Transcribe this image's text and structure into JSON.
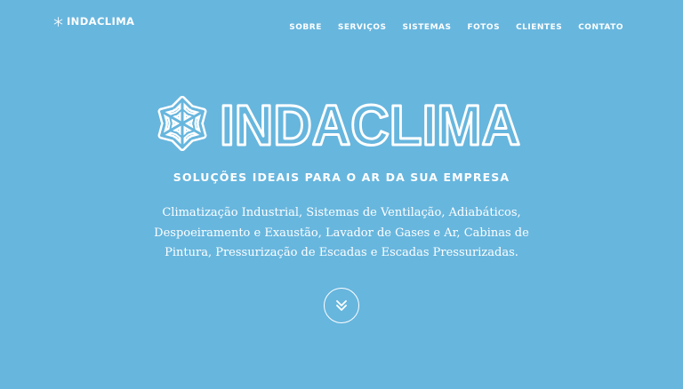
{
  "brand": {
    "name": "INDACLIMA",
    "logo_icon": "snowflake-icon"
  },
  "nav": {
    "items": [
      {
        "label": "SOBRE"
      },
      {
        "label": "SERVIÇOS"
      },
      {
        "label": "SISTEMAS"
      },
      {
        "label": "FOTOS"
      },
      {
        "label": "CLIENTES"
      },
      {
        "label": "CONTATO"
      }
    ]
  },
  "hero": {
    "logo_text": "INDACLIMA",
    "logo_icon": "snowflake-icon",
    "tagline": "SOLUÇÕES IDEAIS PARA O AR DA SUA EMPRESA",
    "description": "Climatização Industrial, Sistemas de Ventilação, Adiabáticos, Despoeiramento e Exaustão, Lavador de Gases e Ar, Cabinas de Pintura, Pressurização de Escadas e Escadas Pressurizadas.",
    "scroll_icon": "double-chevron-down-icon"
  },
  "colors": {
    "background": "#67b6de",
    "foreground": "#ffffff"
  }
}
